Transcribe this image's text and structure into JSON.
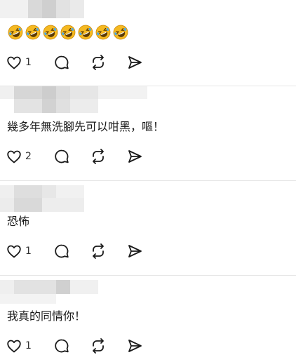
{
  "posts": [
    {
      "text": "",
      "like_count": "1",
      "has_emoji": true,
      "emoji_icon": "rolling-on-floor-laughing-emoji",
      "emoji_count": 7
    },
    {
      "text": "幾多年無洗腳先可以咁黑，嘔！",
      "like_count": "2"
    },
    {
      "text": "恐怖",
      "like_count": "1"
    },
    {
      "text": "我真的同情你！",
      "like_count": "1"
    }
  ],
  "icons": {
    "like": "heart-icon",
    "comment": "comment-icon",
    "repost": "repost-icon",
    "share": "send-icon"
  },
  "colors": {
    "divider": "#e5e5e5",
    "icon": "#1a1a1a",
    "emoji_face": "#f5b921"
  }
}
